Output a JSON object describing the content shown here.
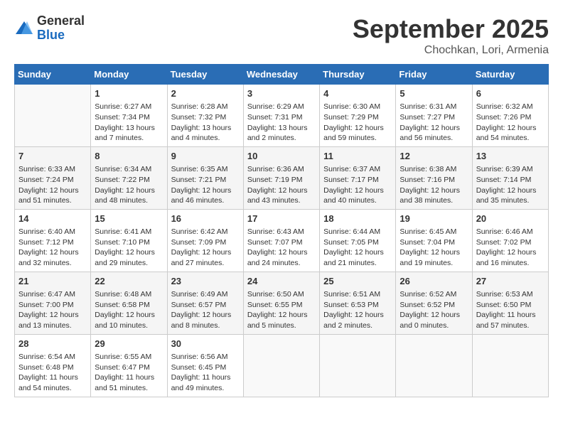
{
  "header": {
    "logo_line1": "General",
    "logo_line2": "Blue",
    "month": "September 2025",
    "location": "Chochkan, Lori, Armenia"
  },
  "weekdays": [
    "Sunday",
    "Monday",
    "Tuesday",
    "Wednesday",
    "Thursday",
    "Friday",
    "Saturday"
  ],
  "weeks": [
    [
      {
        "day": "",
        "info": ""
      },
      {
        "day": "1",
        "info": "Sunrise: 6:27 AM\nSunset: 7:34 PM\nDaylight: 13 hours\nand 7 minutes."
      },
      {
        "day": "2",
        "info": "Sunrise: 6:28 AM\nSunset: 7:32 PM\nDaylight: 13 hours\nand 4 minutes."
      },
      {
        "day": "3",
        "info": "Sunrise: 6:29 AM\nSunset: 7:31 PM\nDaylight: 13 hours\nand 2 minutes."
      },
      {
        "day": "4",
        "info": "Sunrise: 6:30 AM\nSunset: 7:29 PM\nDaylight: 12 hours\nand 59 minutes."
      },
      {
        "day": "5",
        "info": "Sunrise: 6:31 AM\nSunset: 7:27 PM\nDaylight: 12 hours\nand 56 minutes."
      },
      {
        "day": "6",
        "info": "Sunrise: 6:32 AM\nSunset: 7:26 PM\nDaylight: 12 hours\nand 54 minutes."
      }
    ],
    [
      {
        "day": "7",
        "info": "Sunrise: 6:33 AM\nSunset: 7:24 PM\nDaylight: 12 hours\nand 51 minutes."
      },
      {
        "day": "8",
        "info": "Sunrise: 6:34 AM\nSunset: 7:22 PM\nDaylight: 12 hours\nand 48 minutes."
      },
      {
        "day": "9",
        "info": "Sunrise: 6:35 AM\nSunset: 7:21 PM\nDaylight: 12 hours\nand 46 minutes."
      },
      {
        "day": "10",
        "info": "Sunrise: 6:36 AM\nSunset: 7:19 PM\nDaylight: 12 hours\nand 43 minutes."
      },
      {
        "day": "11",
        "info": "Sunrise: 6:37 AM\nSunset: 7:17 PM\nDaylight: 12 hours\nand 40 minutes."
      },
      {
        "day": "12",
        "info": "Sunrise: 6:38 AM\nSunset: 7:16 PM\nDaylight: 12 hours\nand 38 minutes."
      },
      {
        "day": "13",
        "info": "Sunrise: 6:39 AM\nSunset: 7:14 PM\nDaylight: 12 hours\nand 35 minutes."
      }
    ],
    [
      {
        "day": "14",
        "info": "Sunrise: 6:40 AM\nSunset: 7:12 PM\nDaylight: 12 hours\nand 32 minutes."
      },
      {
        "day": "15",
        "info": "Sunrise: 6:41 AM\nSunset: 7:10 PM\nDaylight: 12 hours\nand 29 minutes."
      },
      {
        "day": "16",
        "info": "Sunrise: 6:42 AM\nSunset: 7:09 PM\nDaylight: 12 hours\nand 27 minutes."
      },
      {
        "day": "17",
        "info": "Sunrise: 6:43 AM\nSunset: 7:07 PM\nDaylight: 12 hours\nand 24 minutes."
      },
      {
        "day": "18",
        "info": "Sunrise: 6:44 AM\nSunset: 7:05 PM\nDaylight: 12 hours\nand 21 minutes."
      },
      {
        "day": "19",
        "info": "Sunrise: 6:45 AM\nSunset: 7:04 PM\nDaylight: 12 hours\nand 19 minutes."
      },
      {
        "day": "20",
        "info": "Sunrise: 6:46 AM\nSunset: 7:02 PM\nDaylight: 12 hours\nand 16 minutes."
      }
    ],
    [
      {
        "day": "21",
        "info": "Sunrise: 6:47 AM\nSunset: 7:00 PM\nDaylight: 12 hours\nand 13 minutes."
      },
      {
        "day": "22",
        "info": "Sunrise: 6:48 AM\nSunset: 6:58 PM\nDaylight: 12 hours\nand 10 minutes."
      },
      {
        "day": "23",
        "info": "Sunrise: 6:49 AM\nSunset: 6:57 PM\nDaylight: 12 hours\nand 8 minutes."
      },
      {
        "day": "24",
        "info": "Sunrise: 6:50 AM\nSunset: 6:55 PM\nDaylight: 12 hours\nand 5 minutes."
      },
      {
        "day": "25",
        "info": "Sunrise: 6:51 AM\nSunset: 6:53 PM\nDaylight: 12 hours\nand 2 minutes."
      },
      {
        "day": "26",
        "info": "Sunrise: 6:52 AM\nSunset: 6:52 PM\nDaylight: 12 hours\nand 0 minutes."
      },
      {
        "day": "27",
        "info": "Sunrise: 6:53 AM\nSunset: 6:50 PM\nDaylight: 11 hours\nand 57 minutes."
      }
    ],
    [
      {
        "day": "28",
        "info": "Sunrise: 6:54 AM\nSunset: 6:48 PM\nDaylight: 11 hours\nand 54 minutes."
      },
      {
        "day": "29",
        "info": "Sunrise: 6:55 AM\nSunset: 6:47 PM\nDaylight: 11 hours\nand 51 minutes."
      },
      {
        "day": "30",
        "info": "Sunrise: 6:56 AM\nSunset: 6:45 PM\nDaylight: 11 hours\nand 49 minutes."
      },
      {
        "day": "",
        "info": ""
      },
      {
        "day": "",
        "info": ""
      },
      {
        "day": "",
        "info": ""
      },
      {
        "day": "",
        "info": ""
      }
    ]
  ]
}
